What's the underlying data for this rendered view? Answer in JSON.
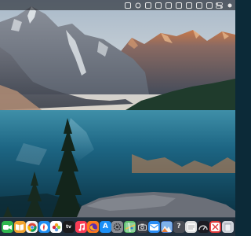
{
  "desktop": {
    "wallpaper": "mountain-lake-wallpaper"
  },
  "menubar": {
    "icons": [
      {
        "name": "menubar-app-1-icon",
        "interactable": true,
        "glyph": "sq"
      },
      {
        "name": "menubar-app-2-icon",
        "interactable": true,
        "glyph": "ring"
      },
      {
        "name": "menubar-app-3-icon",
        "interactable": true,
        "glyph": "sq"
      },
      {
        "name": "menubar-app-4-icon",
        "interactable": true,
        "glyph": "sq"
      },
      {
        "name": "menubar-app-5-icon",
        "interactable": true,
        "glyph": "sq"
      },
      {
        "name": "menubar-app-6-icon",
        "interactable": true,
        "glyph": "sq"
      },
      {
        "name": "menubar-app-7-icon",
        "interactable": true,
        "glyph": "sq"
      },
      {
        "name": "menubar-app-8-icon",
        "interactable": true,
        "glyph": "sq"
      },
      {
        "name": "menubar-app-9-icon",
        "interactable": true,
        "glyph": "sq"
      },
      {
        "name": "control-center-icon",
        "interactable": true,
        "glyph": "toggles"
      },
      {
        "name": "notification-center-icon",
        "interactable": true,
        "glyph": "dot"
      }
    ]
  },
  "dock": {
    "apps": [
      {
        "name": "dock-app-facetime-icon",
        "color": "#2fb84f",
        "glyph": "cam"
      },
      {
        "name": "dock-app-books-icon",
        "color": "#f0a330",
        "glyph": "book"
      },
      {
        "name": "dock-app-chrome-icon",
        "color": "#f4f4f4",
        "glyph": "chrome"
      },
      {
        "name": "dock-app-safari-icon",
        "color": "#1e8ef2",
        "glyph": "compass"
      },
      {
        "name": "dock-app-photos-icon",
        "color": "#ffffff",
        "glyph": "flower"
      },
      {
        "name": "dock-app-apple-tv-icon",
        "color": "#1b1b1d",
        "glyph": "tv"
      },
      {
        "name": "dock-app-music-icon",
        "color": "#fa3c55",
        "glyph": "note"
      },
      {
        "name": "dock-app-firefox-icon",
        "color": "#ff7a1c",
        "glyph": "fox"
      },
      {
        "name": "dock-app-app-store-icon",
        "color": "#1a8ff7",
        "glyph": "A"
      },
      {
        "name": "dock-app-settings-icon",
        "color": "#8a8d93",
        "glyph": "gear"
      },
      {
        "name": "dock-app-maps-icon",
        "color": "#5cbf6a",
        "glyph": "map"
      },
      {
        "name": "dock-app-screenshot-icon",
        "color": "#3a3d45",
        "glyph": "camera"
      },
      {
        "name": "dock-app-mail-icon",
        "color": "#2a8df5",
        "glyph": "mail"
      },
      {
        "name": "dock-app-gallery-icon",
        "color": "#4f7fd1",
        "glyph": "mountain"
      },
      {
        "name": "dock-app-help-icon",
        "color": "#4a4d55",
        "glyph": "?"
      },
      {
        "name": "dock-app-notes-icon",
        "color": "#dedede",
        "glyph": "lines"
      },
      {
        "name": "dock-app-speedtest-icon",
        "color": "#1b1b22",
        "glyph": "gauge"
      },
      {
        "name": "dock-app-launcher-icon",
        "color": "#e23b3b",
        "glyph": "grid"
      },
      {
        "name": "dock-app-trash-icon",
        "color": "#cfd3da",
        "glyph": "trash"
      }
    ]
  }
}
